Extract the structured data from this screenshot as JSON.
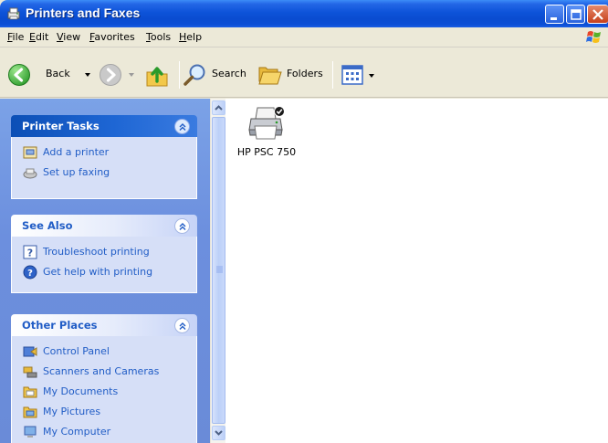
{
  "window": {
    "title": "Printers and Faxes"
  },
  "menu": [
    "File",
    "Edit",
    "View",
    "Favorites",
    "Tools",
    "Help"
  ],
  "toolbar": {
    "back_label": "Back",
    "search_label": "Search",
    "folders_label": "Folders"
  },
  "panels": {
    "printer_tasks": {
      "title": "Printer Tasks",
      "items": [
        {
          "label": "Add a printer",
          "icon": "add-printer-icon"
        },
        {
          "label": "Set up faxing",
          "icon": "fax-icon"
        }
      ]
    },
    "see_also": {
      "title": "See Also",
      "items": [
        {
          "label": "Troubleshoot printing",
          "icon": "help-icon"
        },
        {
          "label": "Get help with printing",
          "icon": "help-globe-icon"
        }
      ]
    },
    "other_places": {
      "title": "Other Places",
      "items": [
        {
          "label": "Control Panel",
          "icon": "control-panel-icon"
        },
        {
          "label": "Scanners and Cameras",
          "icon": "scanner-icon"
        },
        {
          "label": "My Documents",
          "icon": "folder-icon"
        },
        {
          "label": "My Pictures",
          "icon": "pictures-icon"
        },
        {
          "label": "My Computer",
          "icon": "computer-icon"
        }
      ]
    }
  },
  "content": {
    "items": [
      {
        "label": "HP PSC 750",
        "default": true
      }
    ]
  },
  "colors": {
    "titlebar": "#0a4cd0",
    "task_pane": "#6c8fde",
    "link": "#215dc6"
  }
}
